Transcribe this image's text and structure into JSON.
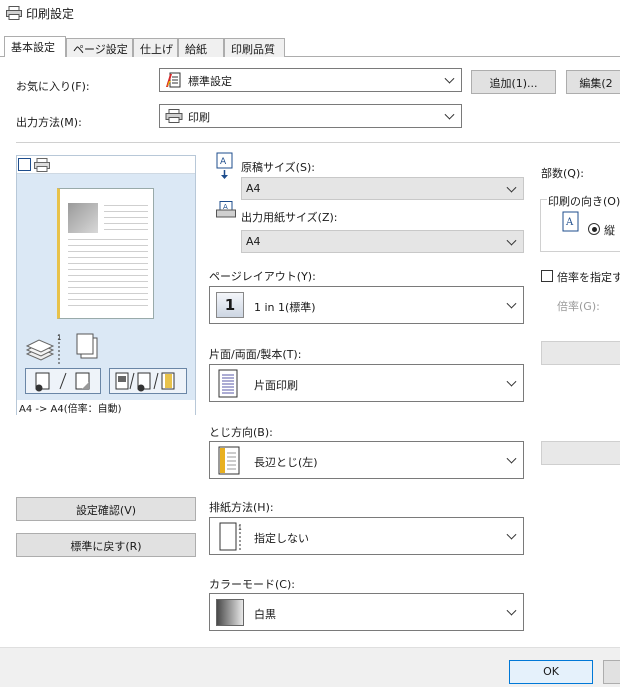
{
  "window": {
    "title": "印刷設定"
  },
  "tabs": [
    {
      "label": "基本設定"
    },
    {
      "label": "ページ設定"
    },
    {
      "label": "仕上げ"
    },
    {
      "label": "給紙"
    },
    {
      "label": "印刷品質"
    }
  ],
  "favorites": {
    "label": "お気に入り(F):",
    "value": "標準設定",
    "add_label": "追加(1)...",
    "edit_label": "編集(2"
  },
  "output_method": {
    "label": "出力方法(M):",
    "value": "印刷"
  },
  "preview": {
    "caption": "A4 -> A4(倍率：自動)"
  },
  "left_buttons": {
    "confirm_label": "設定確認(V)",
    "reset_label": "標準に戻す(R)"
  },
  "original_size": {
    "label": "原稿サイズ(S):",
    "value": "A4"
  },
  "output_size": {
    "label": "出力用紙サイズ(Z):",
    "value": "A4"
  },
  "page_layout": {
    "label": "ページレイアウト(Y):",
    "icon_text": "1",
    "value": "1 in 1(標準)"
  },
  "duplex": {
    "label": "片面/両面/製本(T):",
    "value": "片面印刷"
  },
  "binding": {
    "label": "とじ方向(B):",
    "value": "長辺とじ(左)"
  },
  "output_tray": {
    "label": "排紙方法(H):",
    "value": "指定しない"
  },
  "color_mode": {
    "label": "カラーモード(C):",
    "value": "白黒"
  },
  "copies": {
    "label": "部数(Q):"
  },
  "orientation": {
    "label": "印刷の向き(O)",
    "portrait_label": "縦"
  },
  "scale": {
    "checkbox_label": "倍率を指定す",
    "ratio_label": "倍率(G):"
  },
  "bottom": {
    "ok_label": "OK"
  }
}
